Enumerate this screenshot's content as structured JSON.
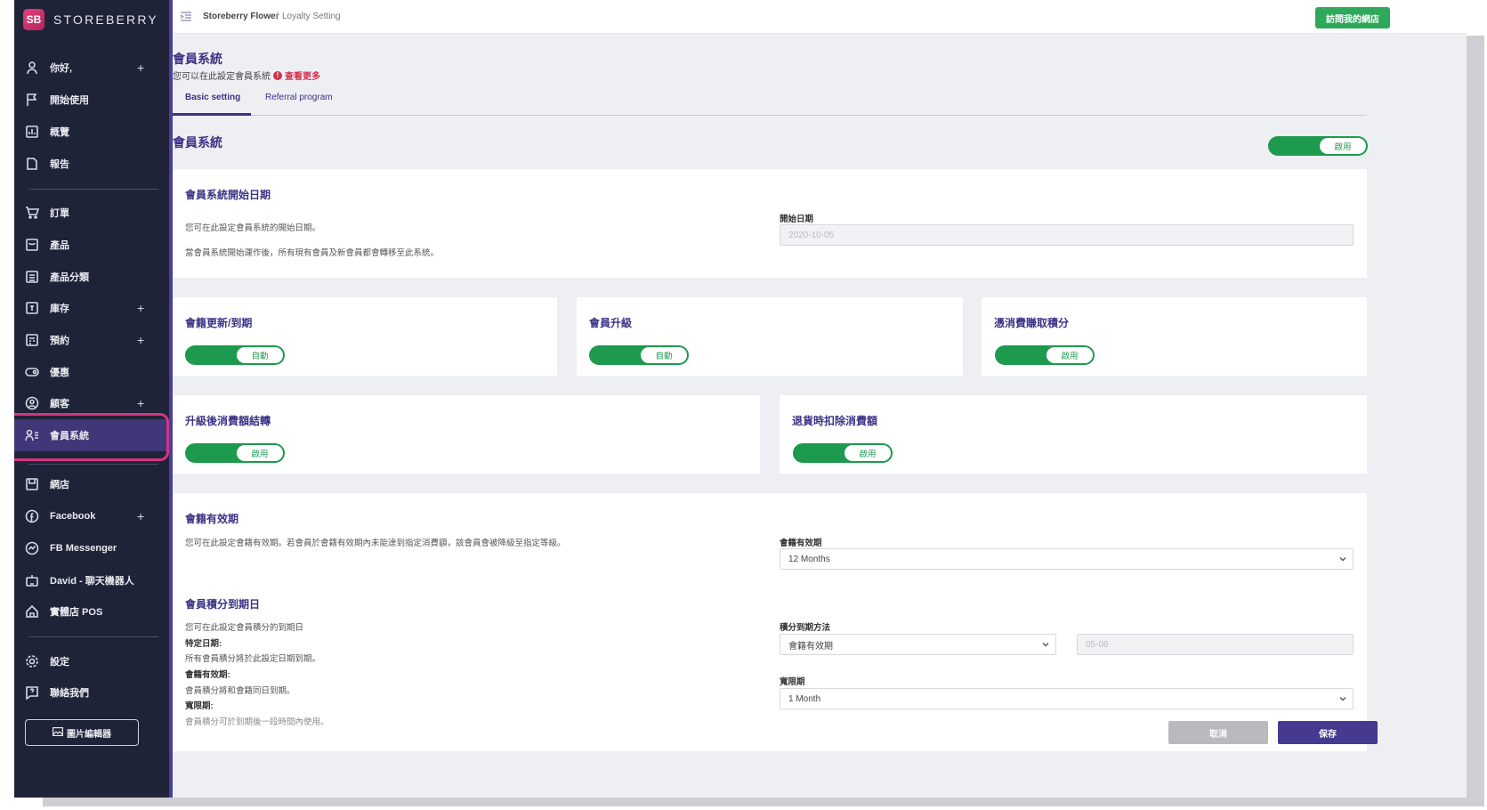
{
  "app": {
    "logo_text": "STOREBERRY",
    "logo_glyph": "SB"
  },
  "sidebar": {
    "items": [
      {
        "label": "你好,",
        "plus": "+"
      },
      {
        "label": "開始使用"
      },
      {
        "label": "概覽"
      },
      {
        "label": "報告"
      },
      {
        "label": "訂單"
      },
      {
        "label": "產品"
      },
      {
        "label": "產品分類"
      },
      {
        "label": "庫存",
        "plus": "+"
      },
      {
        "label": "預約",
        "plus": "+"
      },
      {
        "label": "優惠"
      },
      {
        "label": "顧客",
        "plus": "+"
      },
      {
        "label": "會員系統"
      },
      {
        "label": "網店"
      },
      {
        "label": "Facebook",
        "plus": "+"
      },
      {
        "label": "FB Messenger"
      },
      {
        "label": "David - 聊天機器人"
      },
      {
        "label": "實體店 POS"
      },
      {
        "label": "設定"
      },
      {
        "label": "聯絡我們"
      }
    ],
    "editor_button": "圖片編輯器"
  },
  "header": {
    "breadcrumb_store": "Storeberry Flower",
    "breadcrumb_sep": "/",
    "breadcrumb_page": "Loyalty Setting",
    "visit_button": "訪問我的網店"
  },
  "page": {
    "title": "會員系統",
    "subtitle": "您可以在此設定會員系統",
    "info_glyph": "!",
    "see_more": "查看更多",
    "tabs": [
      "Basic setting",
      "Referral program"
    ],
    "section_title": "會員系統",
    "section_toggle": "啟用"
  },
  "start_card": {
    "title": "會員系統開始日期",
    "desc1": "您可在此設定會員系統的開始日期。",
    "desc2": "當會員系統開始運作後，所有現有會員及新會員都會轉移至此系統。",
    "field_label": "開始日期",
    "field_value": "2020-10-05"
  },
  "toggle_cards": [
    {
      "title": "會籍更新/到期",
      "toggle": "自動"
    },
    {
      "title": "會員升級",
      "toggle": "自動"
    },
    {
      "title": "憑消費賺取積分",
      "toggle": "啟用"
    },
    {
      "title": "升級後消費額結轉",
      "toggle": "啟用"
    },
    {
      "title": "退貨時扣除消費額",
      "toggle": "啟用"
    }
  ],
  "validity_card": {
    "title": "會籍有效期",
    "desc": "您可在此設定會籍有效期。若會員於會籍有效期內未能達到指定消費額，該會員會被降級至指定等級。",
    "field_label": "會籍有效期",
    "field_value": "12 Months",
    "points_title": "會員積分到期日",
    "points_desc": "您可在此設定會員積分的到期日",
    "specific_label": "特定日期:",
    "specific_desc": "所有會員積分將於此設定日期到期。",
    "validity_label": "會籍有效期:",
    "validity_desc": "會員積分將和會籍同日到期。",
    "grace_label": "寬限期:",
    "grace_desc": "會員積分可於到期後一段時間內使用。",
    "method_label": "積分到期方法",
    "method_value": "會籍有效期",
    "date_placeholder": "05-06",
    "grace_field_label": "寬限期",
    "grace_value": "1 Month"
  },
  "actions": {
    "cancel": "取消",
    "save": "保存"
  },
  "colors": {
    "accent": "#3b3285",
    "toggle_green": "#1d9a4d",
    "sidebar_bg": "#1f2337",
    "highlight": "#d63384"
  }
}
